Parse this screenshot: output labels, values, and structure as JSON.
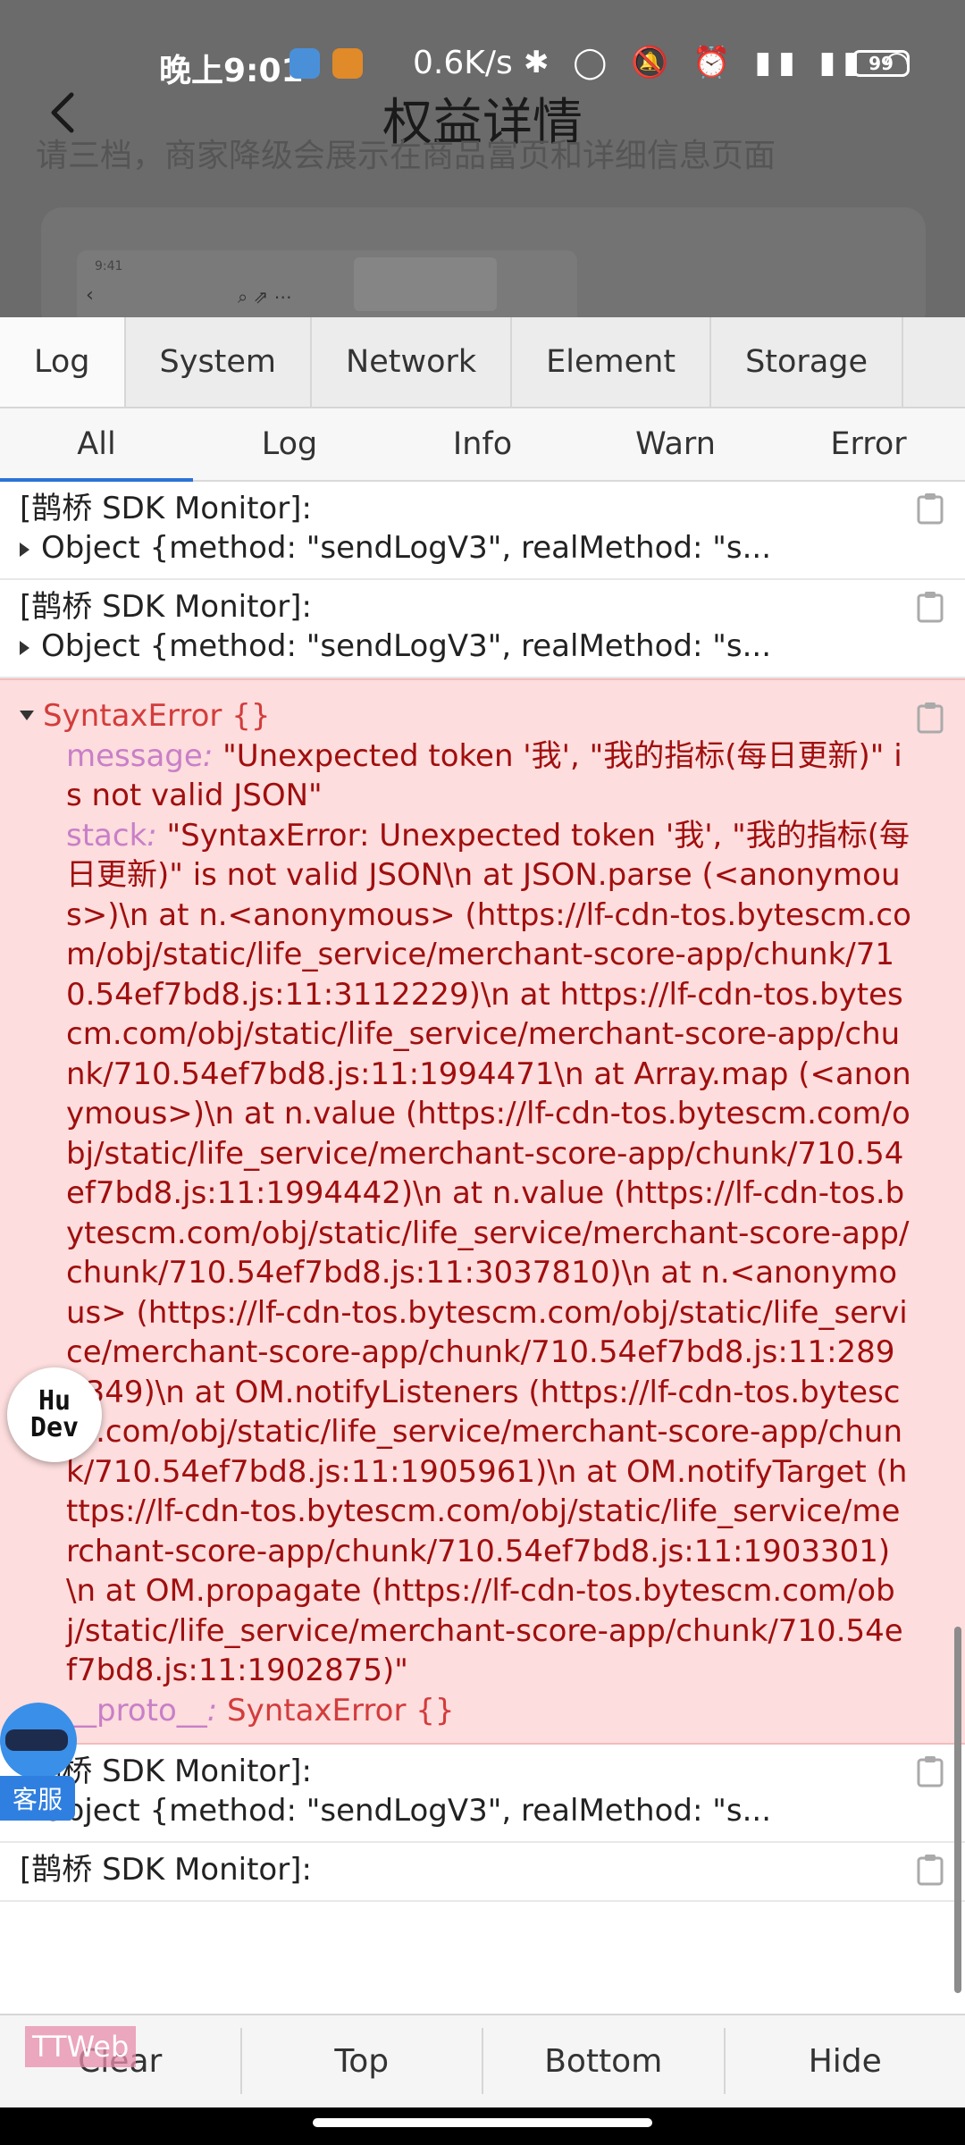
{
  "status_bar": {
    "time": "晚上9:01",
    "net_speed": "0.6K/s",
    "icons": "✱ ◯ 🔕 ⏰ ▮▮ ▮▮ ◠",
    "battery": "99"
  },
  "app": {
    "title": "权益详情",
    "ghost_text": "请三档，商家降级会展示在商品富页和详细信息页面",
    "phone_time": "9:41",
    "phone_icons": "⌕ ⇗ ⋯"
  },
  "console": {
    "main_tabs": [
      "Log",
      "System",
      "Network",
      "Element",
      "Storage"
    ],
    "sub_tabs": [
      "All",
      "Log",
      "Info",
      "Warn",
      "Error"
    ],
    "logs_top": [
      {
        "header": "[鹊桥 SDK Monitor]:",
        "obj": "Object {method: \"sendLogV3\", realMethod: \"s..."
      },
      {
        "header": "[鹊桥 SDK Monitor]:",
        "obj": "Object {method: \"sendLogV3\", realMethod: \"s..."
      }
    ],
    "error": {
      "title": "SyntaxError {}",
      "message_key": "message",
      "message_val": "\"Unexpected token '我', \"我的指标(每日更新)\" is not valid JSON\"",
      "stack_key": "stack",
      "stack_val": "\"SyntaxError: Unexpected token '我', \"我的指标(每日更新)\" is not valid JSON\\n at JSON.parse (<anonymous>)\\n at n.<anonymous> (https://lf-cdn-tos.bytescm.com/obj/static/life_service/merchant-score-app/chunk/710.54ef7bd8.js:11:3112229)\\n at https://lf-cdn-tos.bytescm.com/obj/static/life_service/merchant-score-app/chunk/710.54ef7bd8.js:11:1994471\\n at Array.map (<anonymous>)\\n at n.value (https://lf-cdn-tos.bytescm.com/obj/static/life_service/merchant-score-app/chunk/710.54ef7bd8.js:11:1994442)\\n at n.value (https://lf-cdn-tos.bytescm.com/obj/static/life_service/merchant-score-app/chunk/710.54ef7bd8.js:11:3037810)\\n at n.<anonymous> (https://lf-cdn-tos.bytescm.com/obj/static/life_service/merchant-score-app/chunk/710.54ef7bd8.js:11:2892349)\\n at OM.notifyListeners (https://lf-cdn-tos.bytescm.com/obj/static/life_service/merchant-score-app/chunk/710.54ef7bd8.js:11:1905961)\\n at OM.notifyTarget (https://lf-cdn-tos.bytescm.com/obj/static/life_service/merchant-score-app/chunk/710.54ef7bd8.js:11:1903301)\\n at OM.propagate (https://lf-cdn-tos.bytescm.com/obj/static/life_service/merchant-score-app/chunk/710.54ef7bd8.js:11:1902875)\"",
      "proto_key": "__proto__",
      "proto_val": "SyntaxError {}"
    },
    "logs_bottom": [
      {
        "header": "[鹊桥 SDK Monitor]:",
        "obj": "Object {method: \"sendLogV3\", realMethod: \"s..."
      },
      {
        "header": "[鹊桥 SDK Monitor]:",
        "obj": ""
      }
    ],
    "bottom_buttons": [
      "Clear",
      "Top",
      "Bottom",
      "Hide"
    ],
    "ttweb_tag": "TTWeb"
  },
  "widgets": {
    "hudev_line1": "Hu",
    "hudev_line2": "Dev",
    "customer_service": "客服"
  }
}
